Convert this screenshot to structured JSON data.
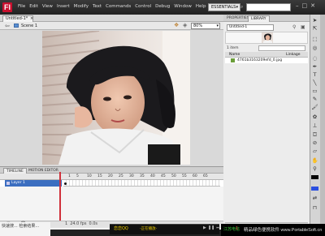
{
  "app": {
    "logo": "Fl",
    "menu": [
      "File",
      "Edit",
      "View",
      "Insert",
      "Modify",
      "Text",
      "Commands",
      "Control",
      "Debug",
      "Window",
      "Help"
    ],
    "workspace": "ESSENTIALS",
    "window_controls": [
      "–",
      "□",
      "✕"
    ]
  },
  "document": {
    "tab_label": "Untitled-1*",
    "tab_close": "×",
    "scene_label": "Scene 1",
    "zoom": "80%"
  },
  "timeline": {
    "tabs": [
      "TIMELINE",
      "MOTION EDITOR"
    ],
    "frame_numbers": [
      "1",
      "5",
      "10",
      "15",
      "20",
      "25",
      "30",
      "35",
      "40",
      "45",
      "50",
      "55",
      "60",
      "65"
    ],
    "layer_name": "Layer 1",
    "footer_frame": "1",
    "footer_fps": "24.0 fps",
    "footer_time": "0.0s"
  },
  "panel": {
    "tabs": [
      "PROPERTIES",
      "LIBRARY"
    ],
    "library": {
      "document_select": "Untitled-1",
      "count": "1 item",
      "col_name": "Name",
      "col_linkage": "Linkage",
      "items": [
        {
          "name": "4761b3163209efd_0.jpg"
        }
      ]
    }
  },
  "tools": {
    "icons": [
      "selection-tool",
      "subselection-tool",
      "free-transform-tool",
      "lasso-tool",
      "pen-tool",
      "text-tool",
      "line-tool",
      "rectangle-tool",
      "pencil-tool",
      "brush-tool",
      "deco-tool",
      "bone-tool",
      "paint-bucket-tool",
      "eyedropper-tool",
      "eraser-tool",
      "hand-tool",
      "zoom-tool"
    ],
    "stroke_color": "#000000",
    "fill_color": "#2a4fe0"
  },
  "taskbar": {
    "left_text_1": "快速搜...",
    "left_text_2": "检索结果...",
    "media_title": "恋恋QQ",
    "media_ticker": "-正在播放-",
    "tray_green": "江苏电信",
    "tray_red": "1",
    "watermark": "精品绿色便携软件 www.PortableSoft.cn"
  },
  "colors": {
    "accent": "#3b6ec0",
    "playhead": "#d0303a",
    "logo": "#c8102e"
  }
}
